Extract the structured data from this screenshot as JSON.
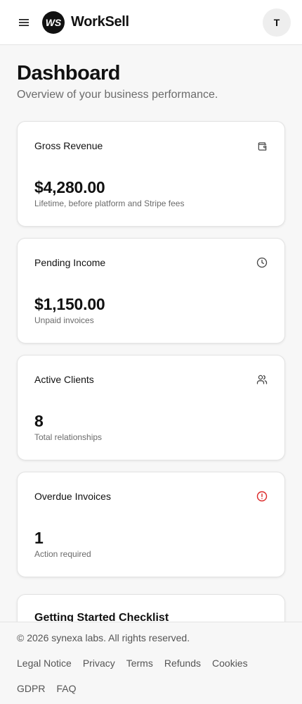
{
  "header": {
    "brand": "WorkSell",
    "logo_text": "WS",
    "avatar_initial": "T",
    "menu_icon": "hamburger-menu-icon"
  },
  "page": {
    "title": "Dashboard",
    "subtitle": "Overview of your business performance."
  },
  "cards": [
    {
      "title": "Gross Revenue",
      "value": "$4,280.00",
      "description": "Lifetime, before platform and Stripe fees",
      "icon": "wallet-icon",
      "icon_color": "#444444"
    },
    {
      "title": "Pending Income",
      "value": "$1,150.00",
      "description": "Unpaid invoices",
      "icon": "clock-icon",
      "icon_color": "#444444"
    },
    {
      "title": "Active Clients",
      "value": "8",
      "description": "Total relationships",
      "icon": "users-icon",
      "icon_color": "#444444"
    },
    {
      "title": "Overdue Invoices",
      "value": "1",
      "description": "Action required",
      "icon": "alert-circle-icon",
      "icon_color": "#dc2626"
    }
  ],
  "checklist": {
    "title": "Getting Started Checklist"
  },
  "footer": {
    "copyright": "© 2026 synexa labs. All rights reserved.",
    "links": [
      "Legal Notice",
      "Privacy",
      "Terms",
      "Refunds",
      "Cookies",
      "GDPR",
      "FAQ"
    ]
  }
}
